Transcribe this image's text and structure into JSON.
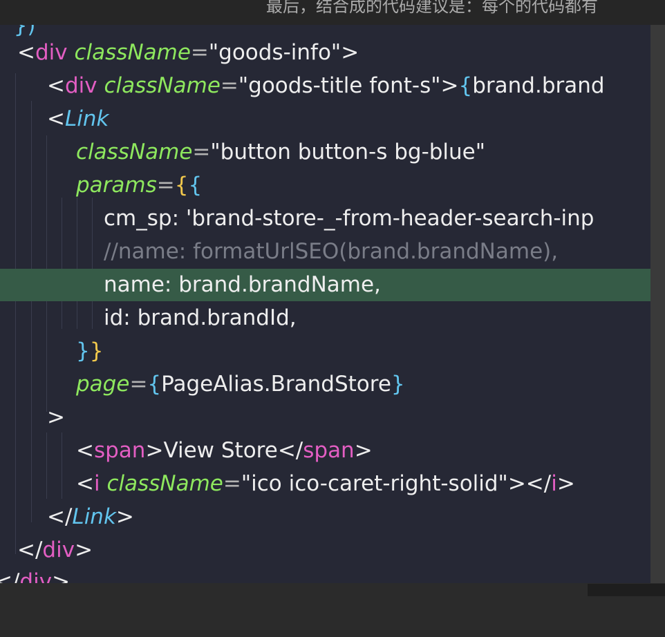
{
  "background_text": "最后，结合成的代码建议是：每个的代码都有",
  "code_lines": [
    "  })",
    "<div className=\"goods-info\">",
    "<div className=\"goods-title font-s\">{brand.brand",
    "<Link",
    "className=\"button button-s bg-blue\"",
    "params={{",
    "cm_sp: 'brand-store-_-from-header-search-inp",
    "//name: formatUrlSEO(brand.brandName),",
    "name: brand.brandName,",
    "id: brand.brandId,",
    "}}",
    "page={PageAlias.BrandStore}",
    ">",
    "<span>View Store</span>",
    "<i className=\"ico ico-caret-right-solid\"></i>",
    "</Link>",
    "</div>",
    "</div>"
  ],
  "tokens": {
    "l1_tag": "div",
    "l1_attr": "className",
    "l1_str": "\"goods-info\"",
    "l2_tag": "div",
    "l2_attr": "className",
    "l2_str": "\"goods-title font-s\"",
    "l2_expr": "brand.brand",
    "l3_comp": "Link",
    "l4_attr": "className",
    "l4_str": "\"button button-s bg-blue\"",
    "l5_attr": "params",
    "l6_key": "cm_sp",
    "l6_str": "'brand-store-_-from-header-search-inp",
    "l7_comment": "//name: formatUrlSEO(brand.brandName),",
    "l8_key": "name",
    "l8_val": "brand.brandName,",
    "l9_key": "id",
    "l9_val": "brand.brandId,",
    "l11_attr": "page",
    "l11_expr": "PageAlias.BrandStore",
    "l13_tag": "span",
    "l13_text": "View Store",
    "l14_tag": "i",
    "l14_attr": "className",
    "l14_str": "\"ico ico-caret-right-solid\"",
    "l15_comp": "Link",
    "l16_tag": "div",
    "l17_tag": "div"
  },
  "colors": {
    "editor_bg": "#262835",
    "highlight_line": "#365b47",
    "tag": "#e35ec3",
    "attribute": "#8ee85e",
    "component": "#62c5ee",
    "brace": "#f2c94c",
    "comment": "#7a7d88"
  }
}
